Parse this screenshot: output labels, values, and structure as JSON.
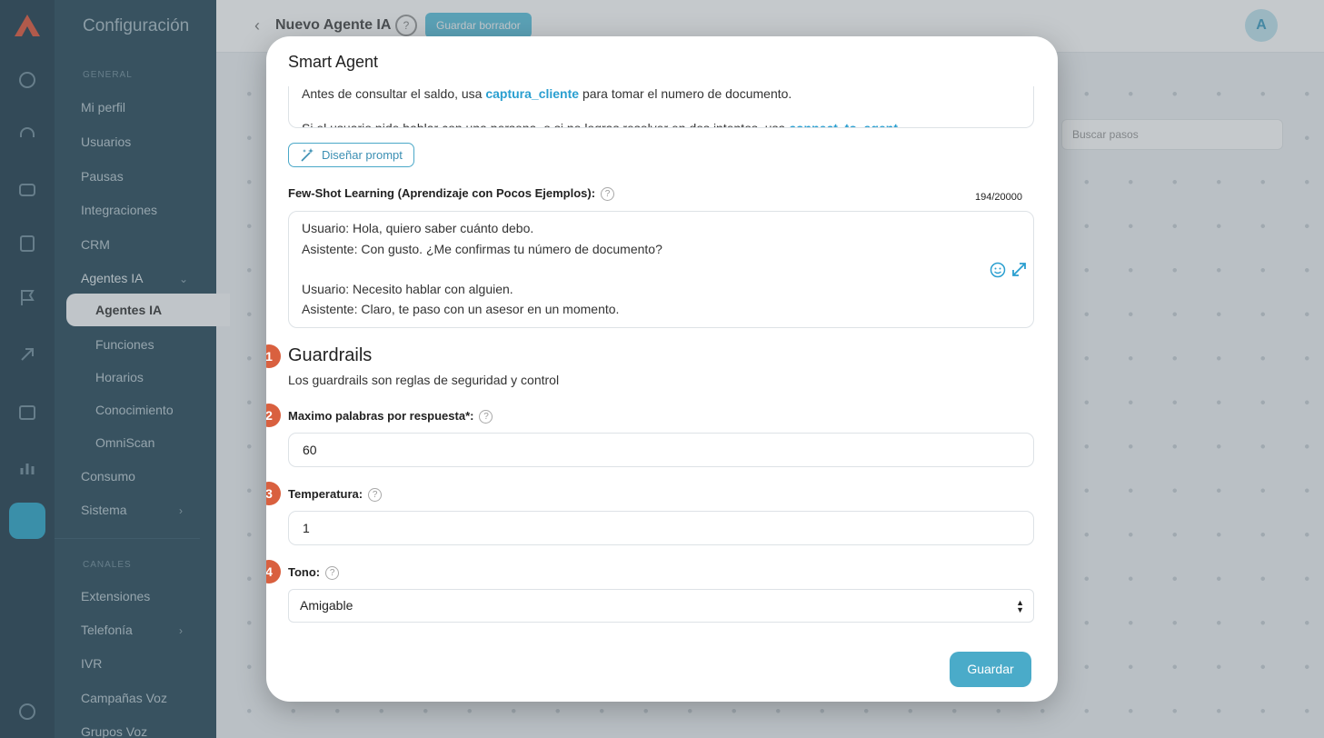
{
  "background": {
    "sidebar": {
      "title": "Configuración",
      "section_general": "GENERAL",
      "items": [
        "Mi perfil",
        "Usuarios",
        "Pausas",
        "Integraciones",
        "CRM",
        "Agentes IA"
      ],
      "sub_items": [
        "Agentes IA",
        "Funciones",
        "Horarios",
        "Conocimiento",
        "OmniScan"
      ],
      "items_after": [
        "Consumo",
        "Sistema"
      ],
      "section_channels": "CANALES",
      "channel_items": [
        "Extensiones",
        "Telefonía",
        "IVR",
        "Campañas Voz",
        "Grupos Voz"
      ]
    },
    "topbar": {
      "title": "Nuevo Agente IA",
      "help": "?",
      "draft_button": "Guardar borrador",
      "avatar": "A"
    },
    "search_steps_placeholder": "Buscar pasos"
  },
  "modal": {
    "title": "Smart Agent",
    "prompt_line1_prefix": "Antes de consultar el saldo, usa ",
    "prompt_line1_link": "captura_cliente",
    "prompt_line1_suffix": " para tomar el numero de documento.",
    "prompt_line2_prefix": "Si el usuario pide hablar con una persona, o si no logras resolver en dos intentos, usa ",
    "prompt_line2_link": "connect_to_agent",
    "design_prompt_button": "Diseñar prompt",
    "fewshot": {
      "label": "Few-Shot Learning (Aprendizaje con Pocos Ejemplos):",
      "counter": "194/20000",
      "lines": [
        "Usuario: Hola, quiero saber cuánto debo.",
        "Asistente: Con gusto. ¿Me confirmas tu número de documento?",
        "Usuario: Necesito hablar con alguien.",
        "Asistente: Claro, te paso con un asesor en un momento."
      ]
    },
    "guardrails": {
      "heading": "Guardrails",
      "description": "Los guardrails son reglas de seguridad y control"
    },
    "max_words": {
      "label": "Maximo palabras por respuesta*:",
      "value": "60"
    },
    "temperature": {
      "label": "Temperatura:",
      "value": "1"
    },
    "tone": {
      "label": "Tono:",
      "value": "Amigable"
    },
    "save_button": "Guardar",
    "steps": [
      "1",
      "2",
      "3",
      "4"
    ]
  },
  "colors": {
    "accent": "#4aabc9",
    "link": "#2a9fd0",
    "step_badge": "#d9603f",
    "sidebar": "#27495a"
  }
}
